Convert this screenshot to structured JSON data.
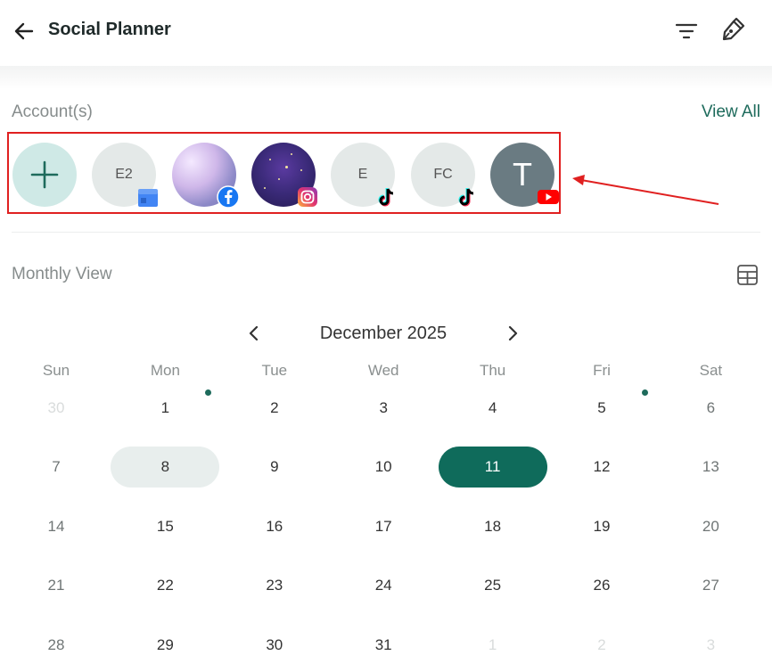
{
  "header": {
    "title": "Social Planner"
  },
  "accounts": {
    "label": "Account(s)",
    "view_all": "View All",
    "items": [
      {
        "initials": "",
        "type": "add",
        "icon": "plus-icon"
      },
      {
        "initials": "E2",
        "type": "google-business",
        "icon": "google-business-icon"
      },
      {
        "initials": "",
        "type": "facebook",
        "icon": "facebook-icon"
      },
      {
        "initials": "",
        "type": "instagram",
        "icon": "instagram-icon"
      },
      {
        "initials": "E",
        "type": "tiktok",
        "icon": "tiktok-icon"
      },
      {
        "initials": "FC",
        "type": "tiktok",
        "icon": "tiktok-icon"
      },
      {
        "initials": "T",
        "type": "youtube",
        "icon": "youtube-icon"
      }
    ]
  },
  "calendar": {
    "view_label": "Monthly View",
    "month_title": "December 2025",
    "weekdays": [
      "Sun",
      "Mon",
      "Tue",
      "Wed",
      "Thu",
      "Fri",
      "Sat"
    ],
    "weeks": [
      [
        "30",
        "1",
        "2",
        "3",
        "4",
        "5",
        "6"
      ],
      [
        "7",
        "8",
        "9",
        "10",
        "11",
        "12",
        "13"
      ],
      [
        "14",
        "15",
        "16",
        "17",
        "18",
        "19",
        "20"
      ],
      [
        "21",
        "22",
        "23",
        "24",
        "25",
        "26",
        "27"
      ],
      [
        "28",
        "29",
        "30",
        "31",
        "1",
        "2",
        "3"
      ]
    ],
    "selected_day": "11",
    "today_day": "8",
    "days_with_posts": [
      "1",
      "5"
    ]
  },
  "colors": {
    "accent": "#0f6b5b",
    "annotation_red": "#e02020"
  }
}
